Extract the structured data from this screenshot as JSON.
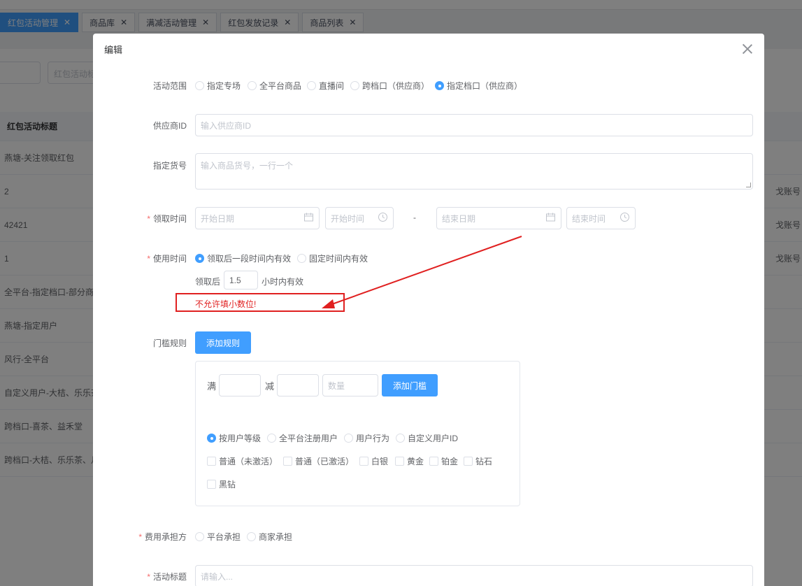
{
  "tabs": [
    {
      "label": "红包活动管理",
      "active": true
    },
    {
      "label": "商品库",
      "active": false
    },
    {
      "label": "满减活动管理",
      "active": false
    },
    {
      "label": "红包发放记录",
      "active": false
    },
    {
      "label": "商品列表",
      "active": false
    }
  ],
  "background": {
    "search_placeholder": "红包活动标",
    "table_header": "红包活动标题",
    "rows": [
      {
        "title": "燕塘-关注领取红包",
        "right": ""
      },
      {
        "title": "2",
        "right": "戈账号"
      },
      {
        "title": "42421",
        "right": "戈账号"
      },
      {
        "title": "1",
        "right": "戈账号"
      },
      {
        "title": "全平台-指定档口-部分商",
        "right": ""
      },
      {
        "title": "燕塘-指定用户",
        "right": ""
      },
      {
        "title": "风行-全平台",
        "right": ""
      },
      {
        "title": "自定义用户-大桔、乐乐茶",
        "right": ""
      },
      {
        "title": "跨档口-喜茶、益禾堂",
        "right": ""
      },
      {
        "title": "跨档口-大桔、乐乐茶、月",
        "right": ""
      }
    ]
  },
  "dialog": {
    "title": "编辑",
    "scope": {
      "label": "活动范围",
      "options": [
        "指定专场",
        "全平台商品",
        "直播间",
        "跨档口（供应商）",
        "指定档口（供应商）"
      ],
      "selected": 4
    },
    "supplier": {
      "label": "供应商ID",
      "placeholder": "输入供应商ID"
    },
    "sku": {
      "label": "指定货号",
      "placeholder": "输入商品货号，一行一个"
    },
    "receive_time": {
      "label": "领取时间",
      "start_date": "开始日期",
      "start_time": "开始时间",
      "sep": "-",
      "end_date": "结束日期",
      "end_time": "结束时间"
    },
    "use_time": {
      "label": "使用时间",
      "options": [
        "领取后一段时间内有效",
        "固定时间内有效"
      ],
      "selected": 0,
      "prefix": "领取后",
      "hours": "1.5",
      "suffix": "小时内有效",
      "error": "不允许填小数位!"
    },
    "threshold": {
      "label": "门槛规则",
      "add_rule": "添加规则",
      "full": "满",
      "minus": "减",
      "qty_placeholder": "数量",
      "add_threshold": "添加门槛",
      "user_types": [
        "按用户等级",
        "全平台注册用户",
        "用户行为",
        "自定义用户ID"
      ],
      "user_type_selected": 0,
      "levels": [
        "普通（未激活）",
        "普通（已激活）",
        "白银",
        "黄金",
        "铂金",
        "钻石",
        "黑钻"
      ]
    },
    "cost": {
      "label": "费用承担方",
      "options": [
        "平台承担",
        "商家承担"
      ]
    },
    "activity_title": {
      "label": "活动标题",
      "placeholder": "请输入..."
    }
  },
  "colors": {
    "primary": "#409eff",
    "error": "#f56c6c",
    "annotation": "#e02020"
  }
}
